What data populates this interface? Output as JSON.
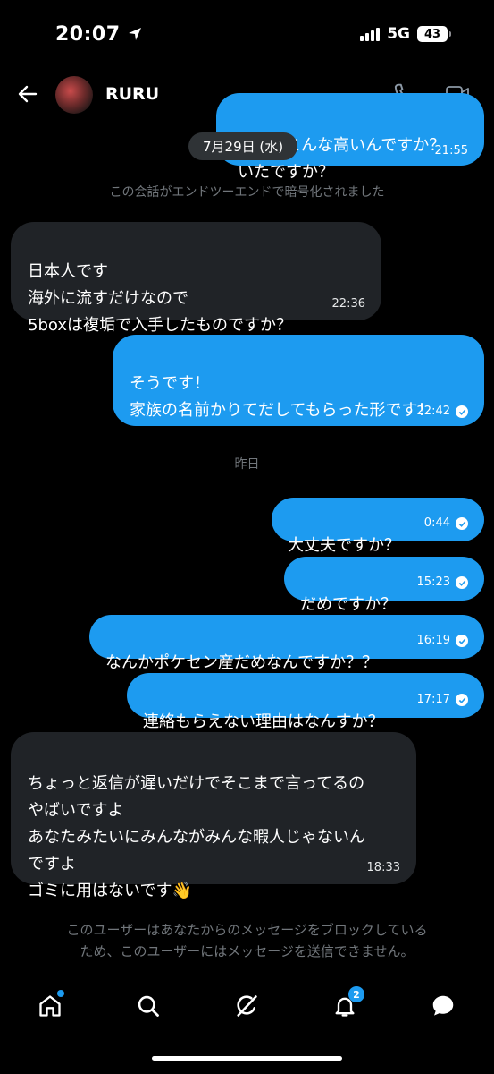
{
  "status_bar": {
    "time": "20:07",
    "network": "5G",
    "battery": "43"
  },
  "header": {
    "contact_name": "RURU"
  },
  "date_pill": "7月29日 (水)",
  "encryption_note": "この会話がエンドツーエンドで暗号化されました",
  "messages": [
    {
      "side": "out",
      "text": "なんでこんな高いんですか？\nいたですか？",
      "time": "21:55",
      "read": false
    },
    {
      "side": "in",
      "text": "日本人です\n海外に流すだけなので\n5boxは複垢で入手したものですか？",
      "time": "22:36"
    },
    {
      "side": "out",
      "text": "そうです！\n家族の名前かりてだしてもらった形です！",
      "time": "22:42",
      "read": true
    },
    {
      "side": "out",
      "text": "大丈夫ですか？",
      "time": "0:44",
      "read": true
    },
    {
      "side": "out",
      "text": "だめですか？",
      "time": "15:23",
      "read": true
    },
    {
      "side": "out",
      "text": "なんかポケセン産だめなんですか？？",
      "time": "16:19",
      "read": true
    },
    {
      "side": "out",
      "text": "連絡もらえない理由はなんすか？",
      "time": "17:17",
      "read": true
    },
    {
      "side": "in",
      "text": "ちょっと返信が遅いだけでそこまで言ってるの\nやばいですよ\nあなたみたいにみんながみんな暇人じゃないん\nですよ\nゴミに用はないです👋",
      "time": "18:33"
    }
  ],
  "day_divider": "昨日",
  "block_notice": "このユーザーはあなたからのメッセージをブロックしている\nため、このユーザーにはメッセージを送信できません。",
  "nav": {
    "items": [
      "home-icon",
      "search-icon",
      "grok-icon",
      "notifications-icon",
      "messages-icon"
    ],
    "notification_count": "2"
  },
  "colors": {
    "accent": "#1d9bf0",
    "incoming_bubble": "#202327",
    "muted_text": "#71767b"
  }
}
